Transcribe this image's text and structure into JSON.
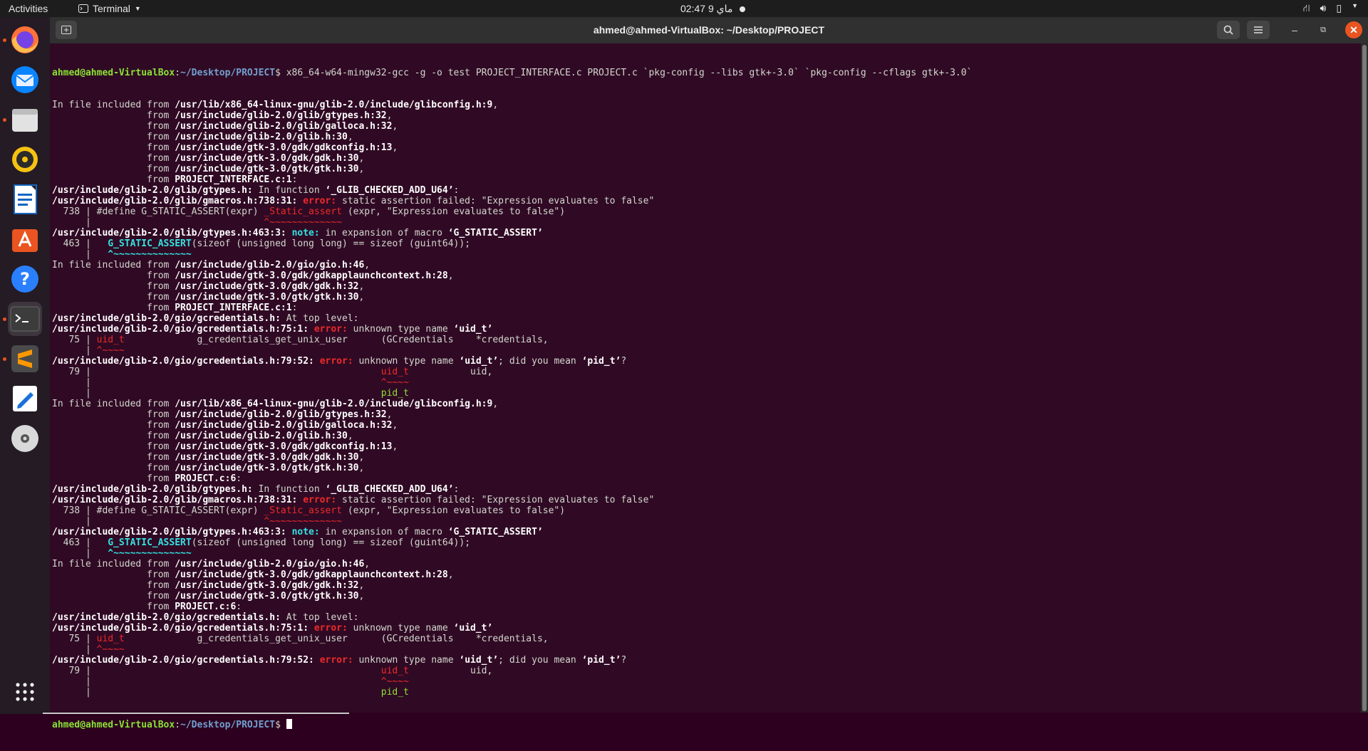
{
  "topbar": {
    "activities": "Activities",
    "app_name": "Terminal",
    "app_icon": "terminal-icon",
    "clock": "ماي 9  02:47",
    "tray_icons": [
      "network-icon",
      "volume-icon",
      "battery-icon",
      "power-menu-icon"
    ]
  },
  "dock": {
    "items": [
      {
        "name": "firefox",
        "icon": "firefox-icon",
        "running": true
      },
      {
        "name": "thunderbird",
        "icon": "mail-icon",
        "running": false
      },
      {
        "name": "files",
        "icon": "folder-icon",
        "running": true
      },
      {
        "name": "rhythmbox",
        "icon": "music-icon",
        "running": false
      },
      {
        "name": "libreoffice-writer",
        "icon": "writer-icon",
        "running": false
      },
      {
        "name": "software",
        "icon": "software-store-icon",
        "running": false
      },
      {
        "name": "help",
        "icon": "help-icon",
        "running": false
      },
      {
        "name": "terminal",
        "icon": "terminal-icon",
        "running": true
      },
      {
        "name": "sublime-text",
        "icon": "sublime-icon",
        "running": true
      },
      {
        "name": "text-editor",
        "icon": "text-editor-icon",
        "running": false
      },
      {
        "name": "dvd",
        "icon": "disc-icon",
        "running": false
      }
    ],
    "show_apps_icon": "apps-grid-icon"
  },
  "window": {
    "title": "ahmed@ahmed-VirtualBox: ~/Desktop/PROJECT",
    "buttons": [
      "new-tab-icon",
      "search-icon",
      "menu-icon",
      "minimize-icon",
      "restore-icon",
      "close-icon"
    ]
  },
  "colors": {
    "terminal_bg": "#300a24",
    "prompt_user": "#8ae234",
    "prompt_path": "#729fcf",
    "error": "#ef2929",
    "note": "#34e2e2",
    "close_button": "#e95420"
  },
  "terminal": {
    "prompt_user": "ahmed@ahmed-VirtualBox",
    "prompt_path": "~/Desktop/PROJECT",
    "command": "$ x86_64-w64-mingw32-gcc -g -o test PROJECT_INTERFACE.c PROJECT.c `pkg-config --libs gtk+-3.0` `pkg-config --cflags gtk+-3.0`",
    "lines": [
      [
        {
          "t": "In file included from "
        },
        {
          "t": "/usr/lib/x86_64-linux-gnu/glib-2.0/include/glibconfig.h:9",
          "s": "b"
        },
        {
          "t": ","
        }
      ],
      [
        {
          "t": "                 from "
        },
        {
          "t": "/usr/include/glib-2.0/glib/gtypes.h:32",
          "s": "b"
        },
        {
          "t": ","
        }
      ],
      [
        {
          "t": "                 from "
        },
        {
          "t": "/usr/include/glib-2.0/glib/galloca.h:32",
          "s": "b"
        },
        {
          "t": ","
        }
      ],
      [
        {
          "t": "                 from "
        },
        {
          "t": "/usr/include/glib-2.0/glib.h:30",
          "s": "b"
        },
        {
          "t": ","
        }
      ],
      [
        {
          "t": "                 from "
        },
        {
          "t": "/usr/include/gtk-3.0/gdk/gdkconfig.h:13",
          "s": "b"
        },
        {
          "t": ","
        }
      ],
      [
        {
          "t": "                 from "
        },
        {
          "t": "/usr/include/gtk-3.0/gdk/gdk.h:30",
          "s": "b"
        },
        {
          "t": ","
        }
      ],
      [
        {
          "t": "                 from "
        },
        {
          "t": "/usr/include/gtk-3.0/gtk/gtk.h:30",
          "s": "b"
        },
        {
          "t": ","
        }
      ],
      [
        {
          "t": "                 from "
        },
        {
          "t": "PROJECT_INTERFACE.c:1",
          "s": "b"
        },
        {
          "t": ":"
        }
      ],
      [
        {
          "t": "/usr/include/glib-2.0/glib/gtypes.h:",
          "s": "b"
        },
        {
          "t": " In function "
        },
        {
          "t": "‘_GLIB_CHECKED_ADD_U64’",
          "s": "b"
        },
        {
          "t": ":"
        }
      ],
      [
        {
          "t": "/usr/include/glib-2.0/glib/gmacros.h:738:31:",
          "s": "b"
        },
        {
          "t": " "
        },
        {
          "t": "error:",
          "s": "redb"
        },
        {
          "t": " static assertion failed: \"Expression evaluates to false\""
        }
      ],
      [
        {
          "t": "  738 | #define G_STATIC_ASSERT(expr) "
        },
        {
          "t": "_Static_assert",
          "s": "red"
        },
        {
          "t": " (expr, \"Expression evaluates to false\")"
        }
      ],
      [
        {
          "t": "      |                               "
        },
        {
          "t": "^~~~~~~~~~~~~~",
          "s": "red"
        }
      ],
      [
        {
          "t": "/usr/include/glib-2.0/glib/gtypes.h:463:3:",
          "s": "b"
        },
        {
          "t": " "
        },
        {
          "t": "note:",
          "s": "cyan"
        },
        {
          "t": " in expansion of macro "
        },
        {
          "t": "‘G_STATIC_ASSERT’",
          "s": "b"
        }
      ],
      [
        {
          "t": "  463 |   "
        },
        {
          "t": "G_STATIC_ASSERT",
          "s": "cyan"
        },
        {
          "t": "(sizeof (unsigned long long) == sizeof (guint64));"
        }
      ],
      [
        {
          "t": "      |   "
        },
        {
          "t": "^~~~~~~~~~~~~~~",
          "s": "cyan"
        }
      ],
      [
        {
          "t": "In file included from "
        },
        {
          "t": "/usr/include/glib-2.0/gio/gio.h:46",
          "s": "b"
        },
        {
          "t": ","
        }
      ],
      [
        {
          "t": "                 from "
        },
        {
          "t": "/usr/include/gtk-3.0/gdk/gdkapplaunchcontext.h:28",
          "s": "b"
        },
        {
          "t": ","
        }
      ],
      [
        {
          "t": "                 from "
        },
        {
          "t": "/usr/include/gtk-3.0/gdk/gdk.h:32",
          "s": "b"
        },
        {
          "t": ","
        }
      ],
      [
        {
          "t": "                 from "
        },
        {
          "t": "/usr/include/gtk-3.0/gtk/gtk.h:30",
          "s": "b"
        },
        {
          "t": ","
        }
      ],
      [
        {
          "t": "                 from "
        },
        {
          "t": "PROJECT_INTERFACE.c:1",
          "s": "b"
        },
        {
          "t": ":"
        }
      ],
      [
        {
          "t": "/usr/include/glib-2.0/gio/gcredentials.h:",
          "s": "b"
        },
        {
          "t": " At top level:"
        }
      ],
      [
        {
          "t": "/usr/include/glib-2.0/gio/gcredentials.h:75:1:",
          "s": "b"
        },
        {
          "t": " "
        },
        {
          "t": "error:",
          "s": "redb"
        },
        {
          "t": " unknown type name "
        },
        {
          "t": "‘uid_t’",
          "s": "b"
        }
      ],
      [
        {
          "t": "   75 | "
        },
        {
          "t": "uid_t",
          "s": "red"
        },
        {
          "t": "             g_credentials_get_unix_user      (GCredentials    *credentials,"
        }
      ],
      [
        {
          "t": "      | "
        },
        {
          "t": "^~~~~",
          "s": "red"
        }
      ],
      [
        {
          "t": "/usr/include/glib-2.0/gio/gcredentials.h:79:52:",
          "s": "b"
        },
        {
          "t": " "
        },
        {
          "t": "error:",
          "s": "redb"
        },
        {
          "t": " unknown type name "
        },
        {
          "t": "‘uid_t’",
          "s": "b"
        },
        {
          "t": "; did you mean "
        },
        {
          "t": "‘pid_t’",
          "s": "b"
        },
        {
          "t": "?"
        }
      ],
      [
        {
          "t": "   79 |                                                    "
        },
        {
          "t": "uid_t",
          "s": "red"
        },
        {
          "t": "           uid,"
        }
      ],
      [
        {
          "t": "      |                                                    "
        },
        {
          "t": "^~~~~",
          "s": "red"
        }
      ],
      [
        {
          "t": "      |                                                    "
        },
        {
          "t": "pid_t",
          "s": "green"
        }
      ],
      [
        {
          "t": "In file included from "
        },
        {
          "t": "/usr/lib/x86_64-linux-gnu/glib-2.0/include/glibconfig.h:9",
          "s": "b"
        },
        {
          "t": ","
        }
      ],
      [
        {
          "t": "                 from "
        },
        {
          "t": "/usr/include/glib-2.0/glib/gtypes.h:32",
          "s": "b"
        },
        {
          "t": ","
        }
      ],
      [
        {
          "t": "                 from "
        },
        {
          "t": "/usr/include/glib-2.0/glib/galloca.h:32",
          "s": "b"
        },
        {
          "t": ","
        }
      ],
      [
        {
          "t": "                 from "
        },
        {
          "t": "/usr/include/glib-2.0/glib.h:30",
          "s": "b"
        },
        {
          "t": ","
        }
      ],
      [
        {
          "t": "                 from "
        },
        {
          "t": "/usr/include/gtk-3.0/gdk/gdkconfig.h:13",
          "s": "b"
        },
        {
          "t": ","
        }
      ],
      [
        {
          "t": "                 from "
        },
        {
          "t": "/usr/include/gtk-3.0/gdk/gdk.h:30",
          "s": "b"
        },
        {
          "t": ","
        }
      ],
      [
        {
          "t": "                 from "
        },
        {
          "t": "/usr/include/gtk-3.0/gtk/gtk.h:30",
          "s": "b"
        },
        {
          "t": ","
        }
      ],
      [
        {
          "t": "                 from "
        },
        {
          "t": "PROJECT.c:6",
          "s": "b"
        },
        {
          "t": ":"
        }
      ],
      [
        {
          "t": "/usr/include/glib-2.0/glib/gtypes.h:",
          "s": "b"
        },
        {
          "t": " In function "
        },
        {
          "t": "‘_GLIB_CHECKED_ADD_U64’",
          "s": "b"
        },
        {
          "t": ":"
        }
      ],
      [
        {
          "t": "/usr/include/glib-2.0/glib/gmacros.h:738:31:",
          "s": "b"
        },
        {
          "t": " "
        },
        {
          "t": "error:",
          "s": "redb"
        },
        {
          "t": " static assertion failed: \"Expression evaluates to false\""
        }
      ],
      [
        {
          "t": "  738 | #define G_STATIC_ASSERT(expr) "
        },
        {
          "t": "_Static_assert",
          "s": "red"
        },
        {
          "t": " (expr, \"Expression evaluates to false\")"
        }
      ],
      [
        {
          "t": "      |                               "
        },
        {
          "t": "^~~~~~~~~~~~~~",
          "s": "red"
        }
      ],
      [
        {
          "t": "/usr/include/glib-2.0/glib/gtypes.h:463:3:",
          "s": "b"
        },
        {
          "t": " "
        },
        {
          "t": "note:",
          "s": "cyan"
        },
        {
          "t": " in expansion of macro "
        },
        {
          "t": "‘G_STATIC_ASSERT’",
          "s": "b"
        }
      ],
      [
        {
          "t": "  463 |   "
        },
        {
          "t": "G_STATIC_ASSERT",
          "s": "cyan"
        },
        {
          "t": "(sizeof (unsigned long long) == sizeof (guint64));"
        }
      ],
      [
        {
          "t": "      |   "
        },
        {
          "t": "^~~~~~~~~~~~~~~",
          "s": "cyan"
        }
      ],
      [
        {
          "t": "In file included from "
        },
        {
          "t": "/usr/include/glib-2.0/gio/gio.h:46",
          "s": "b"
        },
        {
          "t": ","
        }
      ],
      [
        {
          "t": "                 from "
        },
        {
          "t": "/usr/include/gtk-3.0/gdk/gdkapplaunchcontext.h:28",
          "s": "b"
        },
        {
          "t": ","
        }
      ],
      [
        {
          "t": "                 from "
        },
        {
          "t": "/usr/include/gtk-3.0/gdk/gdk.h:32",
          "s": "b"
        },
        {
          "t": ","
        }
      ],
      [
        {
          "t": "                 from "
        },
        {
          "t": "/usr/include/gtk-3.0/gtk/gtk.h:30",
          "s": "b"
        },
        {
          "t": ","
        }
      ],
      [
        {
          "t": "                 from "
        },
        {
          "t": "PROJECT.c:6",
          "s": "b"
        },
        {
          "t": ":"
        }
      ],
      [
        {
          "t": "/usr/include/glib-2.0/gio/gcredentials.h:",
          "s": "b"
        },
        {
          "t": " At top level:"
        }
      ],
      [
        {
          "t": "/usr/include/glib-2.0/gio/gcredentials.h:75:1:",
          "s": "b"
        },
        {
          "t": " "
        },
        {
          "t": "error:",
          "s": "redb"
        },
        {
          "t": " unknown type name "
        },
        {
          "t": "‘uid_t’",
          "s": "b"
        }
      ],
      [
        {
          "t": "   75 | "
        },
        {
          "t": "uid_t",
          "s": "red"
        },
        {
          "t": "             g_credentials_get_unix_user      (GCredentials    *credentials,"
        }
      ],
      [
        {
          "t": "      | "
        },
        {
          "t": "^~~~~",
          "s": "red"
        }
      ],
      [
        {
          "t": "/usr/include/glib-2.0/gio/gcredentials.h:79:52:",
          "s": "b"
        },
        {
          "t": " "
        },
        {
          "t": "error:",
          "s": "redb"
        },
        {
          "t": " unknown type name "
        },
        {
          "t": "‘uid_t’",
          "s": "b"
        },
        {
          "t": "; did you mean "
        },
        {
          "t": "‘pid_t’",
          "s": "b"
        },
        {
          "t": "?"
        }
      ],
      [
        {
          "t": "   79 |                                                    "
        },
        {
          "t": "uid_t",
          "s": "red"
        },
        {
          "t": "           uid,"
        }
      ],
      [
        {
          "t": "      |                                                    "
        },
        {
          "t": "^~~~~",
          "s": "red"
        }
      ],
      [
        {
          "t": "      |                                                    "
        },
        {
          "t": "pid_t",
          "s": "green"
        }
      ]
    ],
    "final_prompt_suffix": "$ "
  }
}
